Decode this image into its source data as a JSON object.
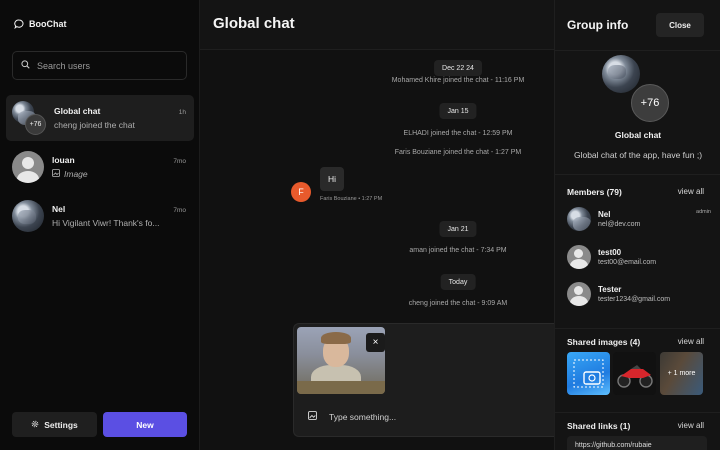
{
  "app": {
    "name": "BooChat"
  },
  "search": {
    "placeholder": "Search users"
  },
  "chats": [
    {
      "name": "Global chat",
      "last_message": "cheng joined the chat",
      "time": "1h",
      "badge": "+76",
      "active": true
    },
    {
      "name": "louan",
      "last_message": "Image",
      "time": "7mo",
      "active": false
    },
    {
      "name": "Nel",
      "last_message": "Hi Vigilant Viwr!  Thank's fo...",
      "time": "7mo",
      "active": false
    }
  ],
  "sidebar_footer": {
    "settings_label": "Settings",
    "new_label": "New"
  },
  "main": {
    "title": "Global chat",
    "timeline": [
      {
        "kind": "date",
        "text": "Dec 22 24"
      },
      {
        "kind": "system",
        "text": "Mohamed Khire joined the chat - 11:16 PM"
      },
      {
        "kind": "date",
        "text": "Jan 15"
      },
      {
        "kind": "system",
        "text": "ELHADI joined the chat - 12:59 PM"
      },
      {
        "kind": "system",
        "text": "Faris Bouziane joined the chat - 1:27 PM"
      },
      {
        "kind": "message",
        "avatar_letter": "F",
        "text": "Hi",
        "meta": "Faris Bouziane • 1:27 PM"
      },
      {
        "kind": "date",
        "text": "Jan 21"
      },
      {
        "kind": "system",
        "text": "aman joined the chat - 7:34 PM"
      },
      {
        "kind": "date",
        "text": "Today"
      },
      {
        "kind": "system",
        "text": "cheng joined the chat - 9:09 AM"
      }
    ],
    "composer": {
      "placeholder": "Type something...",
      "remove_attachment": "×"
    }
  },
  "panel": {
    "title": "Group info",
    "close_label": "Close",
    "group_badge": "+76",
    "group_name": "Global chat",
    "group_description": "Global chat of the app, have fun ;)",
    "members_title": "Members (79)",
    "members_view_all": "view all",
    "members": [
      {
        "name": "Nel",
        "email": "nel@dev.com",
        "role": "admin"
      },
      {
        "name": "test00",
        "email": "test00@email.com",
        "role": ""
      },
      {
        "name": "Tester",
        "email": "tester1234@gmail.com",
        "role": ""
      }
    ],
    "images_title": "Shared images (4)",
    "images_view_all": "view all",
    "images_more": "+ 1 more",
    "links_title": "Shared links (1)",
    "links_view_all": "view all",
    "link_preview": "https://github.com/rubaie"
  },
  "colors": {
    "accent": "#5b4fe3",
    "message_avatar": "#e85a2c",
    "background": "#0b0b0b"
  }
}
